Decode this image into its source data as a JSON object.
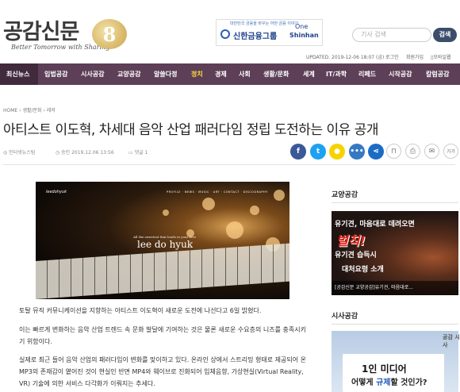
{
  "header": {
    "logo_text": "공감신문",
    "logo_tagline": "Better Tomorrow with Sharing",
    "anniversary": "8",
    "ad_small": "대한민국 금융을 바꾸는 어떤 금융 이야기",
    "ad_brand": "신한금융그룹",
    "ad_one": "One",
    "ad_shinhan": "Shinhan",
    "search_placeholder": "기사 검색",
    "search_button": "검색",
    "updated": "UPDATED. 2019-12-06 18:07 (금)",
    "login": "로그인",
    "signup": "회원가입",
    "mobile": "모바일웹"
  },
  "nav": {
    "items": [
      "최신뉴스",
      "입법공감",
      "시사공감",
      "교양공감",
      "알쓸다정",
      "정치",
      "경제",
      "사회",
      "생활/문화",
      "세계",
      "IT/과학",
      "리페드",
      "시작공감",
      "칼럼공감"
    ]
  },
  "colors": {
    "nav_bg": "#5d3f57",
    "nav_active": "#ffdf3b",
    "search_btn": "#3c4d6c"
  },
  "article": {
    "breadcrumb_home": "HOME",
    "breadcrumb_1": "생활/문화",
    "breadcrumb_2": "레저",
    "title": "아티스트 이도혁, 차세대 음악 산업 패러다임 정립 도전하는 이유 공개",
    "author": "인터넷뉴스팀",
    "date": "승인 2019.12.06 13:56",
    "comments": "댓글 1",
    "hero_brand": "leedohyuk",
    "hero_menu": "PROFILE · NEWS · MUSIC · ART · CONTACT · DISCOGRAPHY",
    "hero_tag": "All the sweetest that leads to your love",
    "hero_name": "lee do hyuk",
    "p1": "토탈 뮤직 커뮤니케이션을 지향하는 아티스트 이도혁이 새로운 도전에 나선다고 6일 밝혔다.",
    "p2": "이는 빠르게 변화하는 음악 산업 트렌드 속 문화 발달에 기여하는 것은 물론 새로운 수요층의 니즈를 충족시키기 위함이다.",
    "p3": "실제로 최근 들어 음악 산업의 패러다임이 변화를 맞이하고 있다. 온라인 상에서 스트리밍 형태로 제공되어 온 MP3의 존재감이 옅어진 것이 현실인 반면 MP4와 웨이브로 진화되어 입체음향, 가상현실(Virtual Reality, VR) 기술에 의한 서비스 다각화가 이뤄지는 추세다."
  },
  "sidebar": {
    "section1": "교양공감",
    "ad1_line1": "유기견, 마음대로 데려오면",
    "ad1_line2": "벌칙!",
    "ad1_line3": "유기견 습득시",
    "ad1_line4": "대처요령 소개",
    "ad1_caption": "[공감신문 교양공감]유기견, 마음대로...",
    "section2": "시사공감",
    "ad2_tag": "공감 시사",
    "ad2_line1": "1인 미디어",
    "ad2_line2a": "어떻게 ",
    "ad2_line2b": "규제",
    "ad2_line2c": "할 것인가?"
  }
}
